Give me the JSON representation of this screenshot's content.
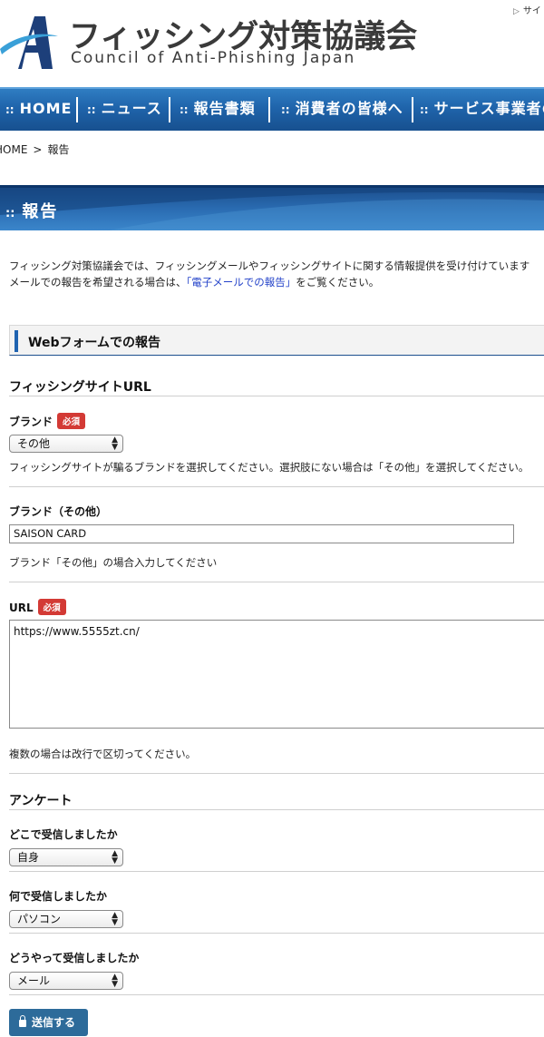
{
  "header": {
    "org_name_jp": "フィッシング対策協議会",
    "org_name_en": "Council of Anti-Phishing Japan",
    "top_link": "サイ",
    "logo_icon": "apc-a-logo-icon",
    "brand_color": "#1f5fa8"
  },
  "nav": {
    "items": [
      {
        "label": "HOME"
      },
      {
        "label": "ニュース"
      },
      {
        "label": "報告書類"
      },
      {
        "label": "消費者の皆様へ"
      },
      {
        "label": "サービス事業者の"
      }
    ]
  },
  "breadcrumb": {
    "home": "HOME",
    "separator": ">",
    "current": "報告"
  },
  "page_title": "報告",
  "intro": {
    "line1": "フィッシング対策協議会では、フィッシングメールやフィッシングサイトに関する情報提供を受け付けています",
    "line2_prefix": "メールでの報告を希望される場合は、",
    "line2_link": "「電子メールでの報告」",
    "line2_suffix": "をご覧ください。"
  },
  "form": {
    "section_title": "Webフォームでの報告",
    "site_heading": "フィッシングサイトURL",
    "required_badge": "必須",
    "brand": {
      "label": "ブランド",
      "value": "その他",
      "help": "フィッシングサイトが騙るブランドを選択してください。選択肢にない場合は「その他」を選択してください。"
    },
    "brand_other": {
      "label": "ブランド（その他）",
      "value": "SAISON CARD",
      "help": "ブランド「その他」の場合入力してください"
    },
    "url": {
      "label": "URL",
      "value": "https://www.5555zt.cn/",
      "help": "複数の場合は改行で区切ってください。"
    },
    "survey_heading": "アンケート",
    "where": {
      "label": "どこで受信しましたか",
      "value": "自身"
    },
    "device": {
      "label": "何で受信しましたか",
      "value": "パソコン"
    },
    "how": {
      "label": "どうやって受信しましたか",
      "value": "メール"
    },
    "submit_label": "送信する",
    "submit_icon": "lock-icon",
    "submit_color": "#2d6b9a",
    "badge_color": "#d33a35"
  }
}
